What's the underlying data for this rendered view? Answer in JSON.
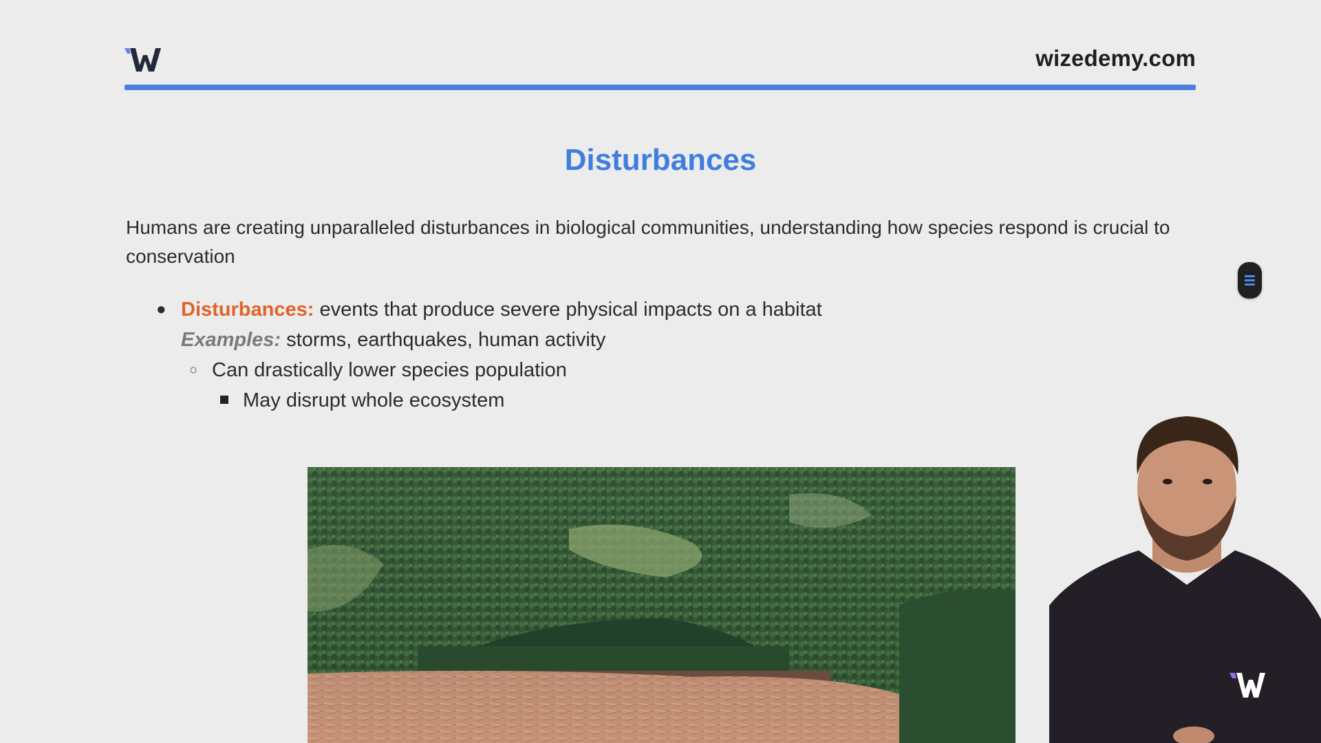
{
  "header": {
    "logo_icon": "wizedemy-w-logo-icon",
    "site_url": "wizedemy.com",
    "accent_color": "#4a7fe0"
  },
  "slide": {
    "title": "Disturbances",
    "intro": "Humans are creating unparalleled disturbances in biological communities, understanding how species respond is crucial to conservation",
    "bullets": {
      "term": "Disturbances:",
      "definition": " events that produce severe physical impacts on a habitat",
      "examples_label": "Examples:",
      "examples_text": " storms, earthquakes, human activity",
      "sub_point": "Can drastically lower species population",
      "sub_sub_point": "May disrupt whole ecosystem"
    },
    "photo_icon": "clearcut-forest-photo"
  },
  "overlay": {
    "menu_icon": "menu-lines-icon",
    "presenter": "presenter-video"
  },
  "colors": {
    "title": "#3f7de0",
    "term": "#e0632a",
    "background": "#ececec"
  }
}
